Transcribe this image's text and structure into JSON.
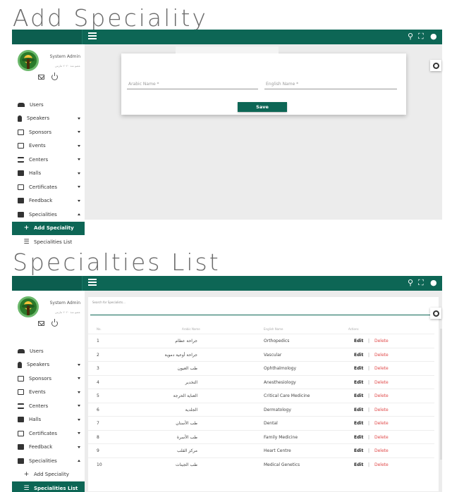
{
  "titles": {
    "add": "Add Speciality",
    "list": "Specialties List"
  },
  "topbar": {
    "search_icon": "search-icon",
    "fullscreen_icon": "fullscreen-icon",
    "account_icon": "account-icon"
  },
  "profile": {
    "name": "System Admin",
    "since": "عضو منذ ٢٠٢٠ مارس",
    "mail_icon": "mail-icon",
    "power_icon": "power-icon"
  },
  "sidebar": {
    "items": [
      {
        "label": "Users",
        "icon": "users-icon"
      },
      {
        "label": "Speakers",
        "icon": "microphone-icon"
      },
      {
        "label": "Sponsors",
        "icon": "dollar-icon"
      },
      {
        "label": "Events",
        "icon": "calendar-icon"
      },
      {
        "label": "Centers",
        "icon": "bank-icon"
      },
      {
        "label": "Halls",
        "icon": "door-icon"
      },
      {
        "label": "Certificates",
        "icon": "certificate-icon"
      },
      {
        "label": "Feedback",
        "icon": "feedback-icon"
      },
      {
        "label": "Specialities",
        "icon": "briefcase-icon"
      }
    ],
    "sub": {
      "add": "Add Speciality",
      "list": "Specialities List"
    }
  },
  "form": {
    "arabic_label": "Arabic Name *",
    "english_label": "English Name *",
    "save": "Save"
  },
  "list": {
    "search_placeholder": "Search for Specialists...",
    "headers": {
      "no": "No.",
      "arabic": "Arabic Name",
      "english": "English Name",
      "actions": "Actions"
    },
    "edit": "Edit",
    "sep": "|",
    "delete": "Delete",
    "rows": [
      {
        "no": "1",
        "ar": "جراحة عظام",
        "en": "Orthopedics"
      },
      {
        "no": "2",
        "ar": "جراحة أوعية دموية",
        "en": "Vascular"
      },
      {
        "no": "3",
        "ar": "طب العيون",
        "en": "Ophthalmology"
      },
      {
        "no": "4",
        "ar": "التخدير",
        "en": "Anesthesiology"
      },
      {
        "no": "5",
        "ar": "العناية الحرجة",
        "en": "Critical Care Medicine"
      },
      {
        "no": "6",
        "ar": "الجلدية",
        "en": "Dermatology"
      },
      {
        "no": "7",
        "ar": "طب الأسنان",
        "en": "Dental"
      },
      {
        "no": "8",
        "ar": "طب الأسرة",
        "en": "Family Medicine"
      },
      {
        "no": "9",
        "ar": "مركز القلب",
        "en": "Heart Centre"
      },
      {
        "no": "10",
        "ar": "طب الجينات",
        "en": "Medical Genetics"
      }
    ]
  },
  "colors": {
    "primary": "#0d6655",
    "delete": "#e04848"
  }
}
